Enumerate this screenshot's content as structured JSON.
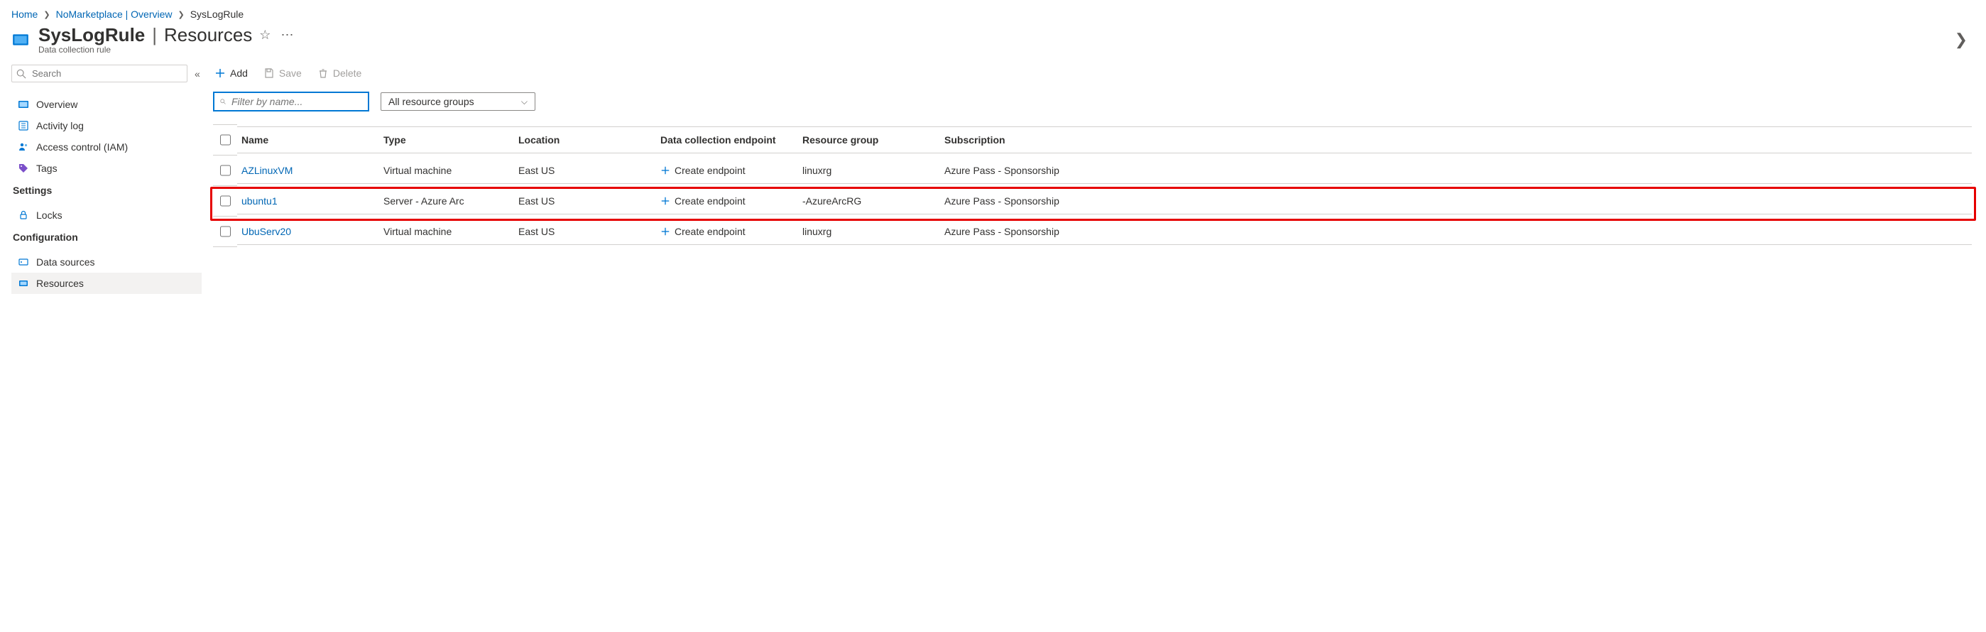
{
  "breadcrumb": {
    "home": "Home",
    "overview": "NoMarketplace | Overview",
    "current": "SysLogRule"
  },
  "header": {
    "title_main": "SysLogRule",
    "title_sub": "Resources",
    "subtitle": "Data collection rule"
  },
  "sidebar": {
    "search_placeholder": "Search",
    "items_top": [
      {
        "label": "Overview"
      },
      {
        "label": "Activity log"
      },
      {
        "label": "Access control (IAM)"
      },
      {
        "label": "Tags"
      }
    ],
    "section_settings": "Settings",
    "items_settings": [
      {
        "label": "Locks"
      }
    ],
    "section_config": "Configuration",
    "items_config": [
      {
        "label": "Data sources"
      },
      {
        "label": "Resources"
      }
    ]
  },
  "toolbar": {
    "add": "Add",
    "save": "Save",
    "delete": "Delete"
  },
  "filters": {
    "name_placeholder": "Filter by name...",
    "rg_label": "All resource groups"
  },
  "table": {
    "headers": {
      "name": "Name",
      "type": "Type",
      "location": "Location",
      "dce": "Data collection endpoint",
      "rg": "Resource group",
      "sub": "Subscription"
    },
    "create_ep": "Create endpoint",
    "rows": [
      {
        "name": "AZLinuxVM",
        "type": "Virtual machine",
        "location": "East US",
        "rg": "linuxrg",
        "sub": "Azure Pass - Sponsorship",
        "highlight": false
      },
      {
        "name": "ubuntu1",
        "type": "Server - Azure Arc",
        "location": "East US",
        "rg": "-AzureArcRG",
        "sub": "Azure Pass - Sponsorship",
        "highlight": true
      },
      {
        "name": "UbuServ20",
        "type": "Virtual machine",
        "location": "East US",
        "rg": "linuxrg",
        "sub": "Azure Pass - Sponsorship",
        "highlight": false
      }
    ]
  }
}
